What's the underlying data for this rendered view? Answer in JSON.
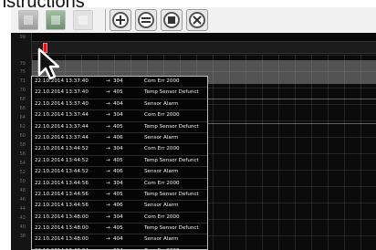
{
  "caption": {
    "text": "nstructions"
  },
  "toolbar": {
    "tool_buttons": [
      {
        "icon": "grid-view-icon",
        "state": "enabled",
        "color": "#a8a8a8"
      },
      {
        "icon": "image-view-icon",
        "state": "enabled",
        "color": "#86a886"
      },
      {
        "icon": "export-icon",
        "state": "disabled",
        "color": "#e2e2e2"
      }
    ],
    "round_buttons": [
      {
        "icon": "zoom-in-icon"
      },
      {
        "icon": "zoom-out-icon"
      },
      {
        "icon": "zoom-fit-icon"
      },
      {
        "icon": "zoom-reset-icon"
      }
    ]
  },
  "gutter": {
    "ticks": [
      "99",
      "79",
      "75",
      "71",
      "70",
      "68",
      "66",
      "64",
      "62",
      "60",
      "58",
      "56",
      "54",
      "52",
      "50",
      "48",
      "46",
      "44",
      "42",
      "40",
      "38"
    ]
  },
  "alarm_log": {
    "marker_color": "#ee1111",
    "rows": [
      {
        "ts": "22.10.2014 13:37:40",
        "arrow": "→",
        "code": "304",
        "msg": "Com Err 2000"
      },
      {
        "ts": "22.10.2014 13:37:40",
        "arrow": "→",
        "code": "405",
        "msg": "Temp Sensor Defunct"
      },
      {
        "ts": "22.10.2014 13:37:40",
        "arrow": "→",
        "code": "404",
        "msg": "Sensor Alarm"
      },
      {
        "ts": "22.10.2014 13:37:44",
        "arrow": "→",
        "code": "304",
        "msg": "Com Err 2000"
      },
      {
        "ts": "22.10.2014 13:37:44",
        "arrow": "→",
        "code": "405",
        "msg": "Temp Sensor Defunct"
      },
      {
        "ts": "22.10.2014 13:37:44",
        "arrow": "→",
        "code": "406",
        "msg": "Sensor Alarm"
      },
      {
        "ts": "22.10.2014 13:44:52",
        "arrow": "→",
        "code": "304",
        "msg": "Com Err 2000"
      },
      {
        "ts": "22.10.2014 13:44:52",
        "arrow": "→",
        "code": "405",
        "msg": "Temp Sensor Defunct"
      },
      {
        "ts": "22.10.2014 13:44:52",
        "arrow": "→",
        "code": "406",
        "msg": "Sensor Alarm"
      },
      {
        "ts": "22.10.2014 13:44:56",
        "arrow": "→",
        "code": "304",
        "msg": "Com Err 2000"
      },
      {
        "ts": "22.10.2014 13:44:56",
        "arrow": "→",
        "code": "405",
        "msg": "Temp Sensor Defunct"
      },
      {
        "ts": "22.10.2014 13:44:56",
        "arrow": "→",
        "code": "406",
        "msg": "Sensor Alarm"
      },
      {
        "ts": "22.10.2014 13:48:00",
        "arrow": "→",
        "code": "304",
        "msg": "Com Err 2000"
      },
      {
        "ts": "22.10.2014 13:48:00",
        "arrow": "→",
        "code": "405",
        "msg": "Temp Sensor Defunct"
      },
      {
        "ts": "22.10.2014 13:48:00",
        "arrow": "→",
        "code": "404",
        "msg": "Sensor Alarm"
      },
      {
        "ts": "22.10.2014 13:48:04",
        "arrow": "→",
        "code": "304",
        "msg": "Com Err 2000"
      }
    ]
  },
  "cursor": {
    "icon": "mouse-pointer-icon"
  }
}
